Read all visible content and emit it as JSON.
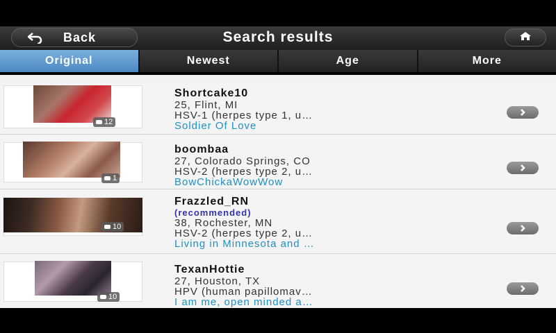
{
  "nav": {
    "back_label": "Back",
    "title": "Search results",
    "back_icon": "back-arrow-icon",
    "home_icon": "home-icon"
  },
  "tabs": [
    {
      "label": "Original",
      "active": true
    },
    {
      "label": "Newest",
      "active": false
    },
    {
      "label": "Age",
      "active": false
    },
    {
      "label": "More",
      "active": false
    }
  ],
  "results": [
    {
      "name": "Shortcake10",
      "recommended": "",
      "location": "25, Flint, MI",
      "condition": "HSV-1 (herpes type 1, u…",
      "tagline": "Soldier Of Love",
      "photo_count": "12"
    },
    {
      "name": "boombaa",
      "recommended": "",
      "location": "27, Colorado Springs, CO",
      "condition": "HSV-2 (herpes type 2, u…",
      "tagline": "BowChickaWowWow",
      "photo_count": "1"
    },
    {
      "name": "Frazzled_RN",
      "recommended": "(recommended)",
      "location": "38, Rochester, MN",
      "condition": "HSV-2 (herpes type 2, u…",
      "tagline": "Living in Minnesota and …",
      "photo_count": "10"
    },
    {
      "name": "TexanHottie",
      "recommended": "",
      "location": "27, Houston, TX",
      "condition": "HPV (human papillomav…",
      "tagline": "I am me, open minded a…",
      "photo_count": "10"
    }
  ],
  "colors": {
    "active_tab": "#5a97cf",
    "tagline": "#1f8fc4",
    "recommended": "#3333aa"
  }
}
